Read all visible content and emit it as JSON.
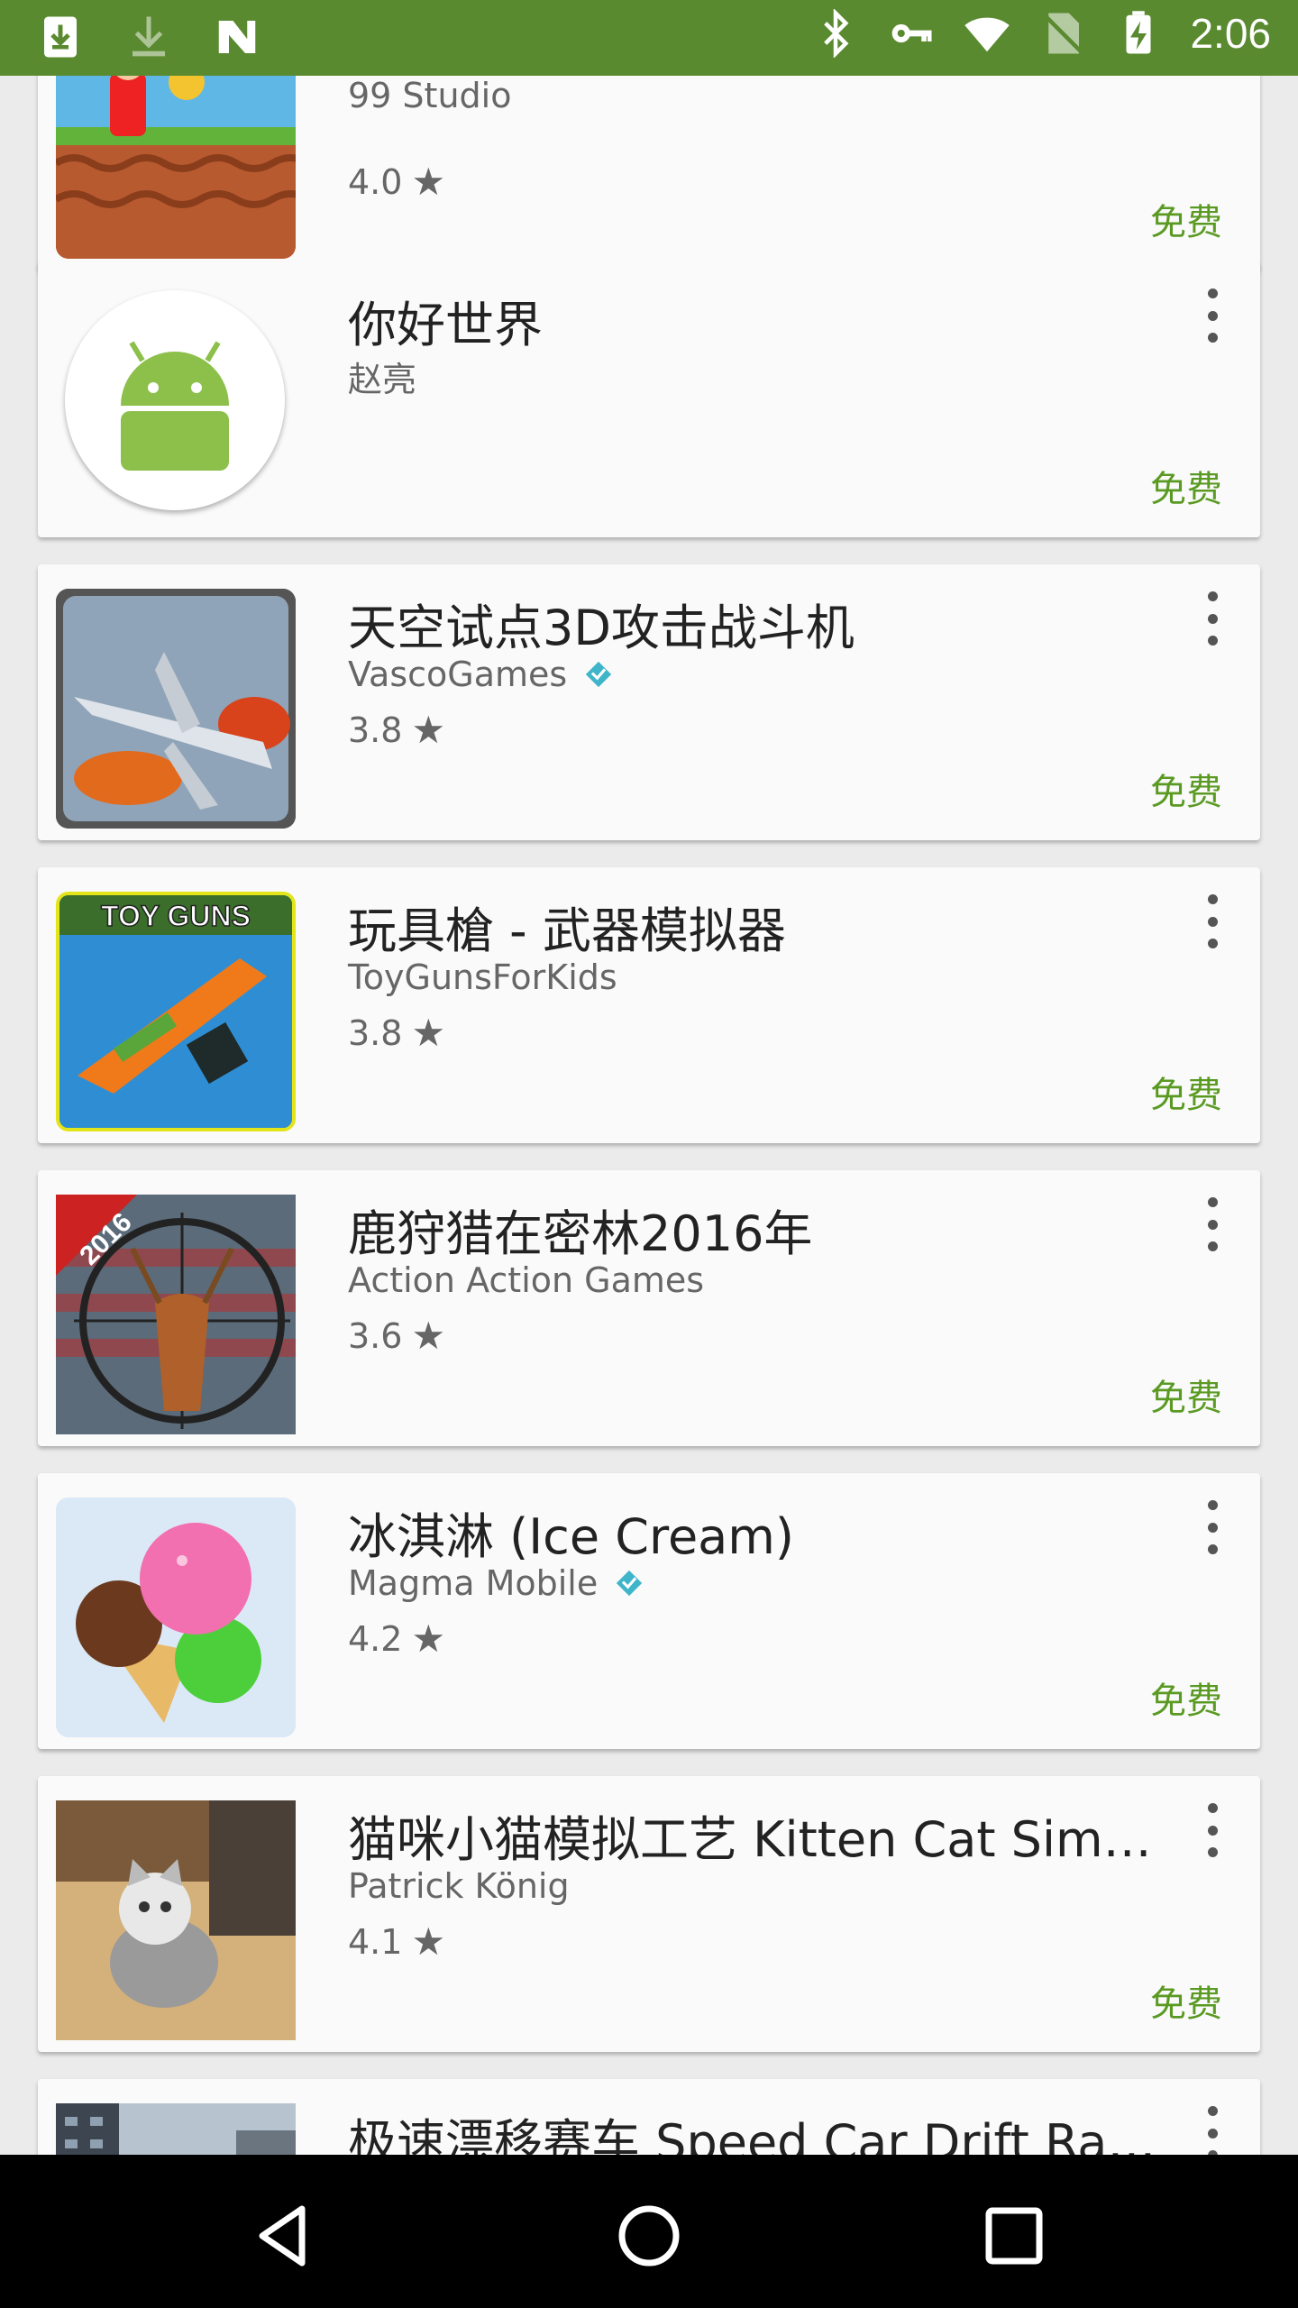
{
  "status_bar": {
    "time": "2:06",
    "left_icons": [
      "download-box-icon",
      "download-arrow-icon",
      "n-logo-icon"
    ],
    "right_icons": [
      "bluetooth-icon",
      "key-icon",
      "wifi-icon",
      "no-sim-icon",
      "battery-charging-icon"
    ],
    "color": "#5a8a2f"
  },
  "apps": [
    {
      "title": "",
      "developer": "99 Studio",
      "rating": "4.0",
      "price": "免费",
      "verified": false,
      "icon": "platformer-game-icon"
    },
    {
      "title": "你好世界",
      "developer": "赵亮",
      "rating": "",
      "price": "免费",
      "verified": false,
      "icon": "android-robot-icon"
    },
    {
      "title": "天空试点3D攻击战斗机",
      "developer": "VascoGames",
      "rating": "3.8",
      "price": "免费",
      "verified": true,
      "icon": "fighter-jet-icon"
    },
    {
      "title": "玩具槍 - 武器模拟器",
      "developer": "ToyGunsForKids",
      "rating": "3.8",
      "price": "免费",
      "verified": false,
      "icon": "toy-gun-icon",
      "icon_text": "TOY GUNS"
    },
    {
      "title": "鹿狩猎在密林2016年",
      "developer": "Action Action Games",
      "rating": "3.6",
      "price": "免费",
      "verified": false,
      "icon": "deer-hunting-icon",
      "icon_text": "2016"
    },
    {
      "title": "冰淇淋 (Ice Cream)",
      "developer": "Magma Mobile",
      "rating": "4.2",
      "price": "免费",
      "verified": true,
      "icon": "ice-cream-icon"
    },
    {
      "title": "猫咪小猫模拟工艺 Kitten Cat Simu..",
      "developer": "Patrick König",
      "rating": "4.1",
      "price": "免费",
      "verified": false,
      "icon": "kitten-icon"
    },
    {
      "title": "极速漂移赛车 Speed Car Drift Raci..",
      "developer": "",
      "rating": "",
      "price": "",
      "verified": false,
      "icon": "city-street-icon"
    }
  ],
  "nav_bar": {
    "buttons": [
      "back-icon",
      "home-icon",
      "recents-icon"
    ]
  },
  "colors": {
    "price": "#5a9a22",
    "verified_badge": "#3fb5c9",
    "card_bg": "#fafafa",
    "page_bg": "#ebebeb"
  }
}
